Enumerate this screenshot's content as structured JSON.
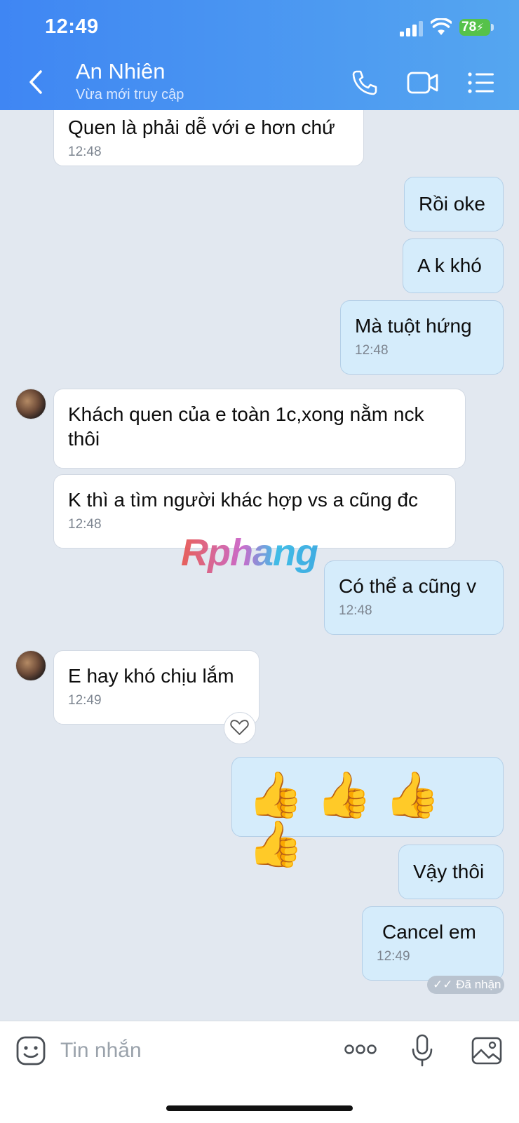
{
  "status_bar": {
    "time": "12:49",
    "battery": "78"
  },
  "header": {
    "name": "An Nhiên",
    "status": "Vừa mới truy cập"
  },
  "messages": [
    {
      "text": "Quen là phải dễ với e hơn chứ",
      "time": "12:48"
    },
    {
      "text": "Rồi oke"
    },
    {
      "text": "A k khó"
    },
    {
      "text": "Mà tuột hứng",
      "time": "12:48"
    },
    {
      "text": "Khách quen của e toàn 1c,xong nằm nck",
      "text2": "thôi"
    },
    {
      "text": "K thì a tìm người khác hợp vs a cũng đc",
      "time": "12:48"
    },
    {
      "text": "Có thể a cũng v",
      "time": "12:48"
    },
    {
      "text": "E hay khó chịu lắm",
      "time": "12:49"
    },
    {
      "text": "👍 👍 👍 👍"
    },
    {
      "text": "Vậy thôi"
    },
    {
      "text": "Cancel em",
      "time": "12:49"
    }
  ],
  "received_label": "Đã nhận",
  "watermark": "Rphang",
  "input": {
    "placeholder": "Tin nhắn"
  },
  "icons": [
    "back-icon",
    "phone-icon",
    "video-call-icon",
    "menu-icon",
    "heart-icon",
    "sticker-icon",
    "more-icon",
    "mic-icon",
    "image-icon"
  ]
}
